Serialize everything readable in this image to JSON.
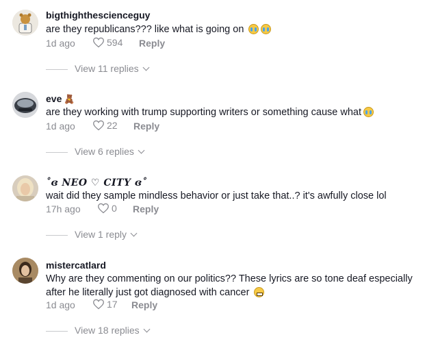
{
  "comments": [
    {
      "username": "bigthighthescienceguy",
      "username_emoji": "",
      "text": "are they republicans??? like what is going on",
      "time": "1d ago",
      "likes": "594",
      "reply_label": "Reply",
      "view_replies": "View 11 replies"
    },
    {
      "username": "eve",
      "username_emoji": "🧸",
      "text": "are they working with trump supporting writers or something cause what",
      "time": "1d ago",
      "likes": "22",
      "reply_label": "Reply",
      "view_replies": "View 6 replies"
    },
    {
      "username": "˚ɞ NEO ♡ CITY ɞ˚",
      "username_emoji": "",
      "text": "wait did they sample mindless behavior or just take that..? it's awfully close lol",
      "time": "17h ago",
      "likes": "0",
      "reply_label": "Reply",
      "view_replies": "View 1 reply"
    },
    {
      "username": "mistercatlard",
      "username_emoji": "",
      "text": "Why are they commenting on our politics?? These lyrics are so tone deaf especially after he literally just got diagnosed with cancer",
      "time": "1d ago",
      "likes": "17",
      "reply_label": "Reply",
      "view_replies": "View 18 replies"
    }
  ],
  "icons": {
    "like": "heart-outline-icon",
    "view_more": "chevron-down-icon",
    "emoji_cry": "loudly-crying-face-icon",
    "emoji_grimace": "grimacing-face-icon"
  },
  "colors": {
    "text": "#161823",
    "secondary": "#8a8b91",
    "background": "#ffffff"
  }
}
